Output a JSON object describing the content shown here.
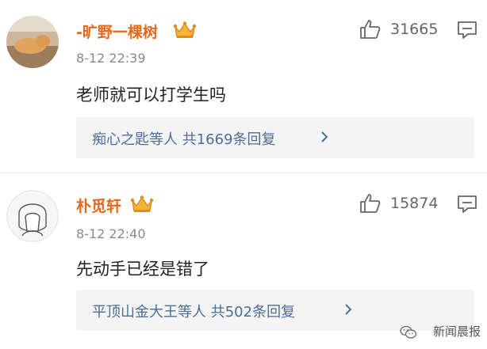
{
  "comments": [
    {
      "username": "-旷野一棵树",
      "timestamp": "8-12 22:39",
      "text": "老师就可以打学生吗",
      "likes": "31665",
      "replies_summary": "痴心之匙等人 共1669条回复",
      "badge_icon": "crown-badge-icon",
      "username_color": "#e8671b"
    },
    {
      "username": "朴觅轩",
      "timestamp": "8-12 22:40",
      "text": "先动手已经是错了",
      "likes": "15874",
      "replies_summary": "平顶山金大王等人 共502条回复",
      "badge_icon": "crown-badge-icon",
      "username_color": "#e8671b"
    }
  ],
  "watermark": {
    "text": "新闻晨报",
    "icon": "wechat-icon"
  }
}
